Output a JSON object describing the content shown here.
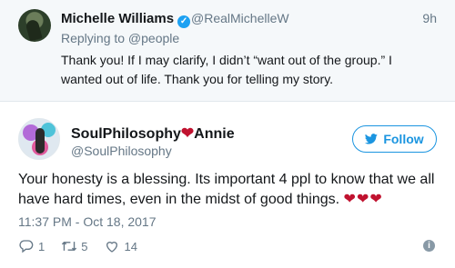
{
  "parent_tweet": {
    "name": "Michelle Williams",
    "handle": "@RealMichelleW",
    "time": "9h",
    "replying_to": "Replying to @people",
    "text": "Thank you! If I may clarify, I didn’t “want out of the group.” I wanted out of life. Thank you for telling my story."
  },
  "main_tweet": {
    "name": "SoulPhilosophy",
    "name_suffix": "Annie",
    "handle": "@SoulPhilosophy",
    "follow_label": "Follow",
    "text": "Your honesty is a blessing. Its important 4 ppl to know that we all have hard times, even in the midst of good things.",
    "emoji": "❤❤❤",
    "timestamp": "11:37 PM - Oct 18, 2017",
    "replies": "1",
    "retweets": "5",
    "likes": "14"
  },
  "colors": {
    "accent": "#1b95e0",
    "secondary_text": "#657786",
    "heart": "#c0122f",
    "parent_bg": "#f5f8fa"
  },
  "icons": [
    "verified-icon",
    "reply-icon",
    "retweet-icon",
    "like-icon",
    "info-icon",
    "twitter-bird-icon"
  ]
}
